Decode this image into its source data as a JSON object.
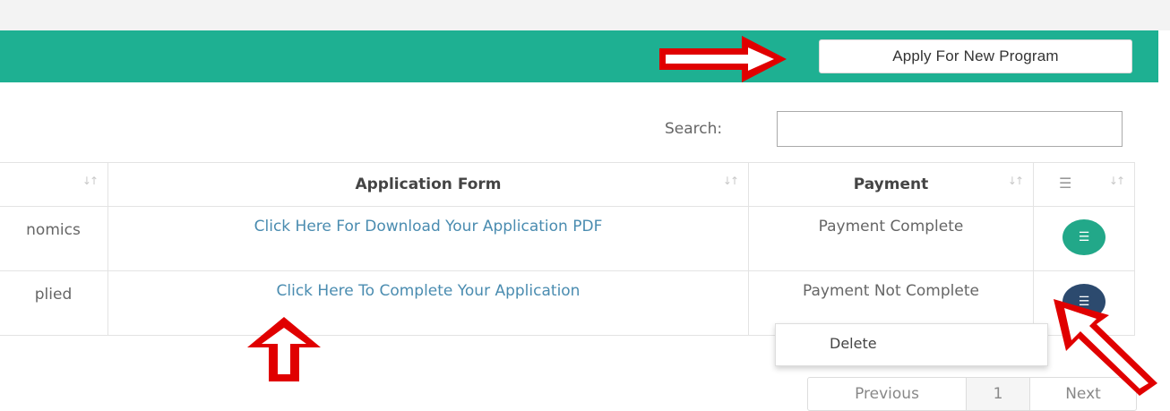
{
  "header": {
    "apply_button": "Apply For New Program",
    "bar_color": "#1eb092"
  },
  "search": {
    "label": "Search:",
    "value": ""
  },
  "table": {
    "columns": [
      "",
      "Application Form",
      "Payment",
      ""
    ],
    "rows": [
      {
        "col1": "nomics",
        "application_form": "Click Here For Download Your Application PDF",
        "payment": "Payment Complete",
        "action_color": "#22a889"
      },
      {
        "col1": "plied",
        "application_form": "Click Here To Complete Your Application",
        "payment": "Payment Not Complete",
        "action_color": "#2c4a6e"
      }
    ]
  },
  "dropdown": {
    "items": [
      "Delete"
    ]
  },
  "pagination": {
    "previous": "Previous",
    "current": "1",
    "next": "Next"
  },
  "annotations": {
    "arrow_color": "#e00000"
  }
}
